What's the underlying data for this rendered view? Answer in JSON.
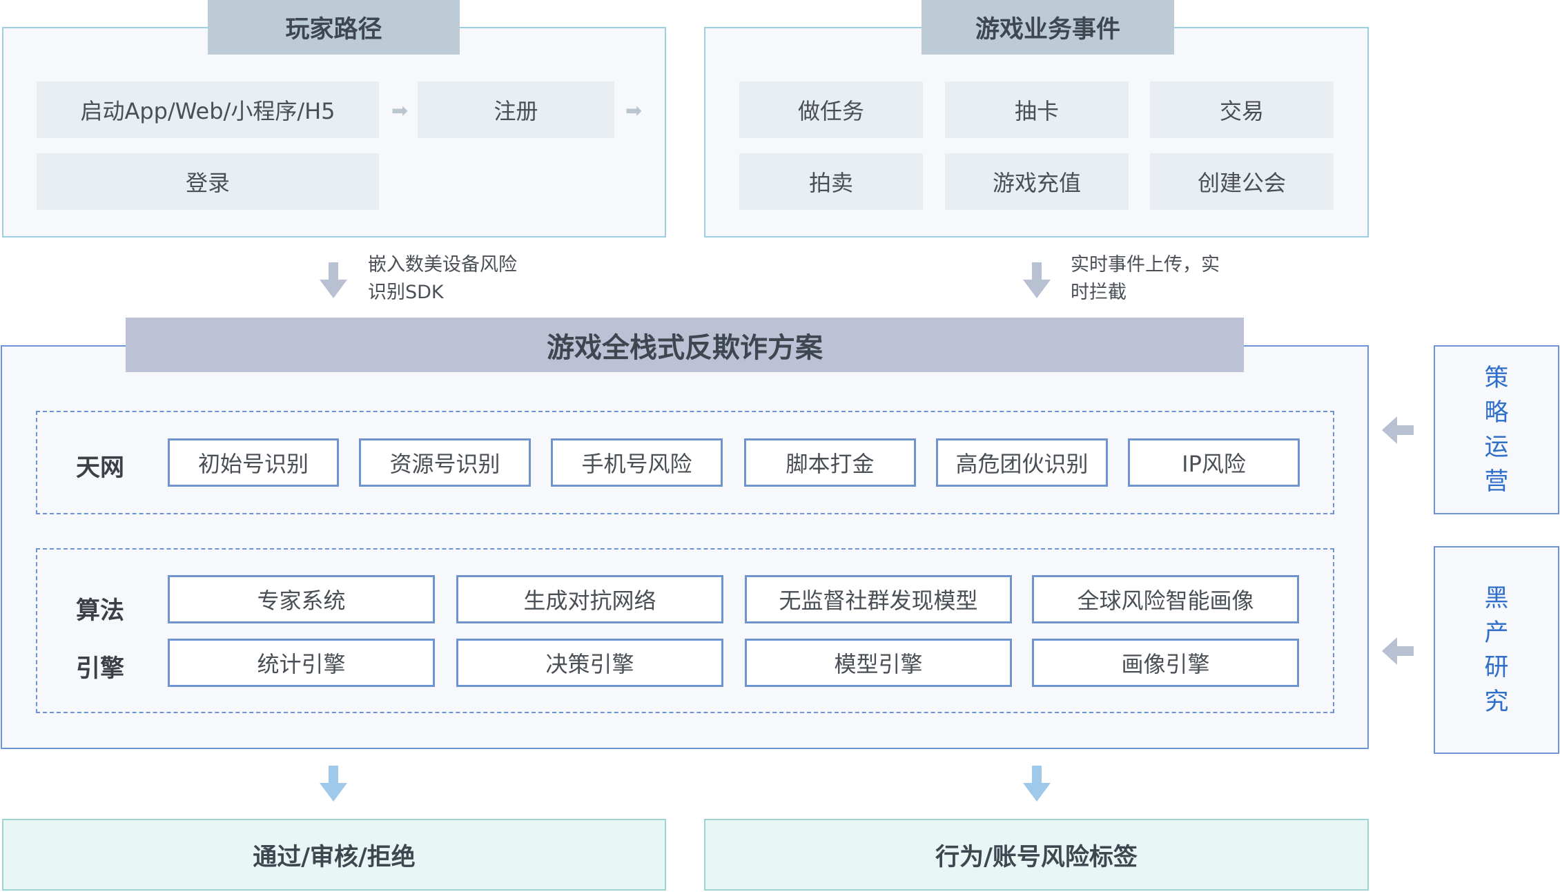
{
  "player_path": {
    "title": "玩家路径",
    "steps": [
      "启动App/Web/小程序/H5",
      "注册",
      "登录"
    ]
  },
  "game_events": {
    "title": "游戏业务事件",
    "items": [
      "做任务",
      "抽卡",
      "交易",
      "拍卖",
      "游戏充值",
      "创建公会"
    ]
  },
  "flow_notes": {
    "left": [
      "嵌入数美设备风险",
      "识别SDK"
    ],
    "right": [
      "实时事件上传，实",
      "时拦截"
    ]
  },
  "solution": {
    "title": "游戏全栈式反欺诈方案",
    "tianwang": {
      "label": "天网",
      "items": [
        "初始号识别",
        "资源号识别",
        "手机号风险",
        "脚本打金",
        "高危团伙识别",
        "IP风险"
      ]
    },
    "engines": {
      "label_line1": "算法",
      "label_line2": "引擎",
      "row1": [
        "专家系统",
        "生成对抗网络",
        "无监督社群发现模型",
        "全球风险智能画像"
      ],
      "row2": [
        "统计引擎",
        "决策引擎",
        "模型引擎",
        "画像引擎"
      ]
    }
  },
  "side_panels": {
    "strategy": "策略运营",
    "blackmarket": "黑产研究"
  },
  "outputs": {
    "left": "通过/审核/拒绝",
    "right": "行为/账号风险标签"
  },
  "colors": {
    "panel_border": "#9dcde0",
    "core_border": "#6b93d6",
    "accent_text": "#2f6fc9",
    "arrow_blue": "#9ec9ea",
    "arrow_gray": "#b8c1d2"
  }
}
